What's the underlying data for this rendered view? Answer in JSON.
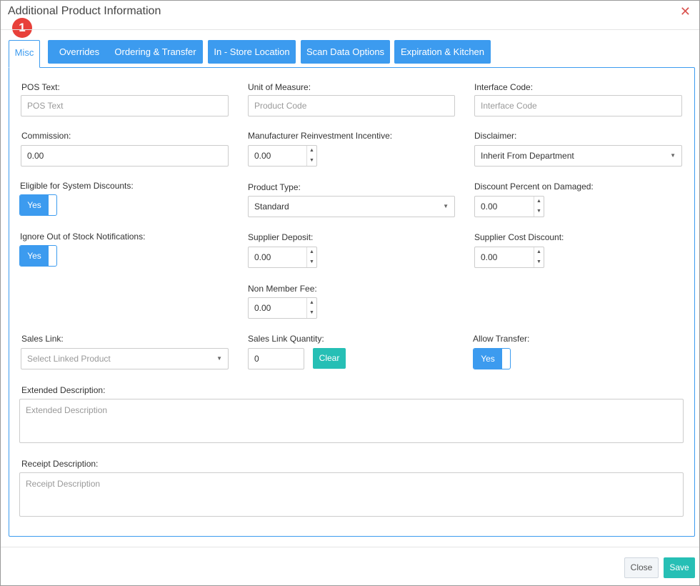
{
  "dialog": {
    "title": "Additional Product Information",
    "close_glyph": "✕",
    "badge": "1"
  },
  "tabs": [
    {
      "label": "Misc"
    },
    {
      "label": "Overrides"
    },
    {
      "label": "Ordering & Transfer"
    },
    {
      "label": "In - Store Location"
    },
    {
      "label": "Scan Data Options"
    },
    {
      "label": "Expiration & Kitchen"
    }
  ],
  "fields": {
    "pos_text": {
      "label": "POS Text:",
      "placeholder": "POS Text"
    },
    "unit_of_measure": {
      "label": "Unit of Measure:",
      "placeholder": "Product Code"
    },
    "interface_code": {
      "label": "Interface Code:",
      "placeholder": "Interface Code"
    },
    "commission": {
      "label": "Commission:",
      "value": "0.00"
    },
    "manufacturer_incentive": {
      "label": "Manufacturer Reinvestment Incentive:",
      "value": "0.00"
    },
    "disclaimer": {
      "label": "Disclaimer:",
      "value": "Inherit From Department"
    },
    "eligible_discounts": {
      "label": "Eligible for System Discounts:",
      "value": "Yes"
    },
    "product_type": {
      "label": "Product Type:",
      "value": "Standard"
    },
    "discount_damaged": {
      "label": "Discount Percent on Damaged:",
      "value": "0.00"
    },
    "ignore_stock": {
      "label": "Ignore Out of Stock Notifications:",
      "value": "Yes"
    },
    "supplier_deposit": {
      "label": "Supplier Deposit:",
      "value": "0.00"
    },
    "supplier_cost_discount": {
      "label": "Supplier Cost Discount:",
      "value": "0.00"
    },
    "non_member_fee": {
      "label": "Non Member Fee:",
      "value": "0.00"
    },
    "sales_link": {
      "label": "Sales Link:",
      "placeholder": "Select Linked Product"
    },
    "sales_link_qty": {
      "label": "Sales Link Quantity:",
      "value": "0",
      "clear_label": "Clear"
    },
    "allow_transfer": {
      "label": "Allow Transfer:",
      "value": "Yes"
    },
    "extended_description": {
      "label": "Extended Description:",
      "placeholder": "Extended Description"
    },
    "receipt_description": {
      "label": "Receipt Description:",
      "placeholder": "Receipt Description"
    }
  },
  "footer": {
    "close_label": "Close",
    "save_label": "Save"
  },
  "colors": {
    "accent": "#3c9bef",
    "teal": "#26bfb5",
    "badge": "#e8403a",
    "close": "#d9534f"
  }
}
